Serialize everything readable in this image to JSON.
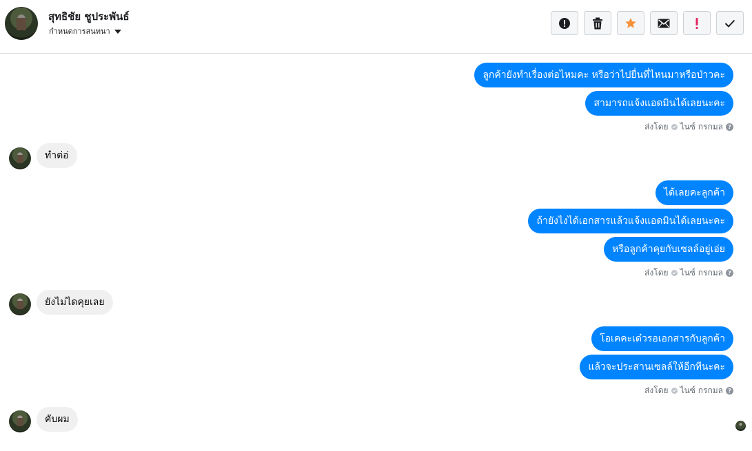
{
  "header": {
    "name": "สุทธิชัย ชูประพันธ์",
    "subtitle": "กำหนดการสนทนา",
    "actions": [
      {
        "icon": "alert-circle-icon",
        "name": "report-button"
      },
      {
        "icon": "trash-icon",
        "name": "delete-button"
      },
      {
        "icon": "star-icon",
        "name": "star-button"
      },
      {
        "icon": "envelope-icon",
        "name": "mark-unread-button"
      },
      {
        "icon": "exclamation-icon",
        "name": "mark-spam-button"
      },
      {
        "icon": "checkmark-icon",
        "name": "mark-done-button"
      }
    ]
  },
  "colors": {
    "outgoing": "#0084ff",
    "incoming": "#f1f0f0",
    "star": "#f7923b",
    "spam": "#e0245e"
  },
  "messages": [
    {
      "dir": "out",
      "text": "ลูกค้ายังทำเรื่องต่อไหมคะ หรือว่าไปยื่นที่ไหนมาหรือป่าวคะ"
    },
    {
      "dir": "out",
      "text": "สามารถแจ้งแอดมินได้เลยนะคะ"
    },
    {
      "dir": "meta",
      "prefix": "ส่งโดย",
      "sender": "ไนซ์ กรกมล"
    },
    {
      "dir": "in",
      "text": "ทำต่อ่"
    },
    {
      "dir": "out",
      "text": "ได้เลยคะลูกค้า"
    },
    {
      "dir": "out",
      "text": "ถ้ายังไงได้เอกสารแล้วแจ้งแอดมินได้เลยนะคะ"
    },
    {
      "dir": "out",
      "text": "หรือลูกค้าคุยกับเซลล์อยู่เอ่ย"
    },
    {
      "dir": "meta",
      "prefix": "ส่งโดย",
      "sender": "ไนซ์ กรกมล"
    },
    {
      "dir": "in",
      "text": "ยังไม่ไดคุยเลย"
    },
    {
      "dir": "out",
      "text": "โอเคคะเด๋วรอเอกสารกับลูกค้า"
    },
    {
      "dir": "out",
      "text": "แล้วจะประสานเซลล์ให้อีกทีนะคะ"
    },
    {
      "dir": "meta",
      "prefix": "ส่งโดย",
      "sender": "ไนซ์ กรกมล"
    },
    {
      "dir": "in",
      "text": "คับผม"
    }
  ]
}
